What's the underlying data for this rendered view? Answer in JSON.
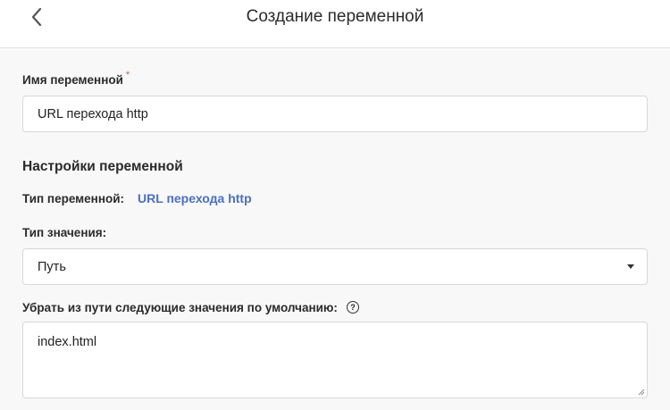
{
  "header": {
    "title": "Создание переменной",
    "back_icon": "chevron-left-icon"
  },
  "variable_name": {
    "label": "Имя переменной",
    "required_mark": "*",
    "value": "URL перехода http"
  },
  "settings": {
    "section_title": "Настройки переменной",
    "type_label": "Тип переменной:",
    "type_value": "URL перехода http",
    "value_type_label": "Тип значения:",
    "value_type_selected": "Путь",
    "remove_label": "Убрать из пути следующие значения по умолчанию:",
    "help_icon": "question-circle-icon",
    "remove_value": "index.html"
  },
  "colors": {
    "link": "#4a6fbf",
    "required": "#d9534f"
  }
}
